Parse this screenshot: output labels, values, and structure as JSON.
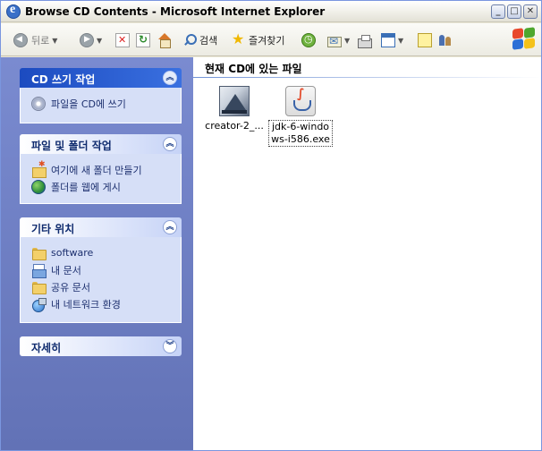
{
  "window": {
    "title": "Browse CD Contents - Microsoft Internet Explorer",
    "buttons": {
      "minimize": "_",
      "maximize": "□",
      "close": "✕"
    }
  },
  "toolbar": {
    "back_label": "뒤로",
    "search_label": "검색",
    "favorites_label": "즐겨찾기"
  },
  "tasks": {
    "cd_panel": {
      "title": "CD 쓰기 작업",
      "items": [
        {
          "label": "파일을 CD에 쓰기",
          "icon": "cd-icon"
        }
      ]
    },
    "file_panel": {
      "title": "파일 및 폴더 작업",
      "items": [
        {
          "label": "여기에 새 폴더 만들기",
          "icon": "new-folder-icon"
        },
        {
          "label": "폴더를 웹에 게시",
          "icon": "publish-web-icon"
        }
      ]
    },
    "places_panel": {
      "title": "기타 위치",
      "items": [
        {
          "label": "software",
          "icon": "folder-icon"
        },
        {
          "label": "내 문서",
          "icon": "my-documents-icon"
        },
        {
          "label": "공유 문서",
          "icon": "shared-folder-icon"
        },
        {
          "label": "내 네트워크 환경",
          "icon": "network-icon"
        }
      ]
    },
    "details_panel": {
      "title": "자세히"
    }
  },
  "content": {
    "title": "현재 CD에 있는 파일",
    "files": [
      {
        "label": "creator-2_...",
        "icon": "installer-icon",
        "selected": false
      },
      {
        "label": "jdk-6-windows-i586.exe",
        "icon": "java-icon",
        "selected": true
      }
    ]
  }
}
